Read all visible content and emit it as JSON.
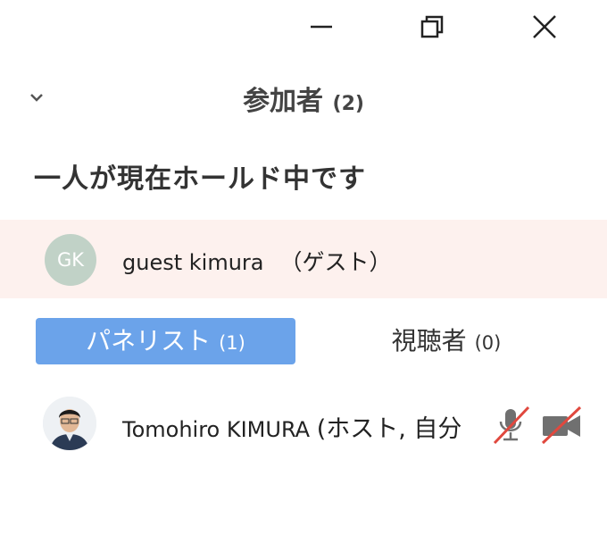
{
  "window": {
    "minimize_icon": "minimize-icon",
    "restore_icon": "restore-icon",
    "close_icon": "close-icon"
  },
  "panel": {
    "title": "参加者",
    "count": "(2)"
  },
  "hold": {
    "heading": "一人が現在ホールド中です",
    "guest": {
      "initials": "GK",
      "name": "guest kimura",
      "tag": "（ゲスト）"
    }
  },
  "tabs": {
    "panelists": {
      "label": "パネリスト",
      "count": "(1)"
    },
    "viewers": {
      "label": "視聴者",
      "count": "(0)"
    }
  },
  "panelists": [
    {
      "name": "Tomohiro KIMURA",
      "role": "(ホスト, 自分",
      "mic": "mic-muted-icon",
      "camera": "video-off-icon"
    }
  ],
  "colors": {
    "hold_background": "#fdf1ee",
    "active_tab": "#6ba3ea",
    "muted_red": "#e0483e",
    "avatar_gk": "#c1d2c7"
  }
}
